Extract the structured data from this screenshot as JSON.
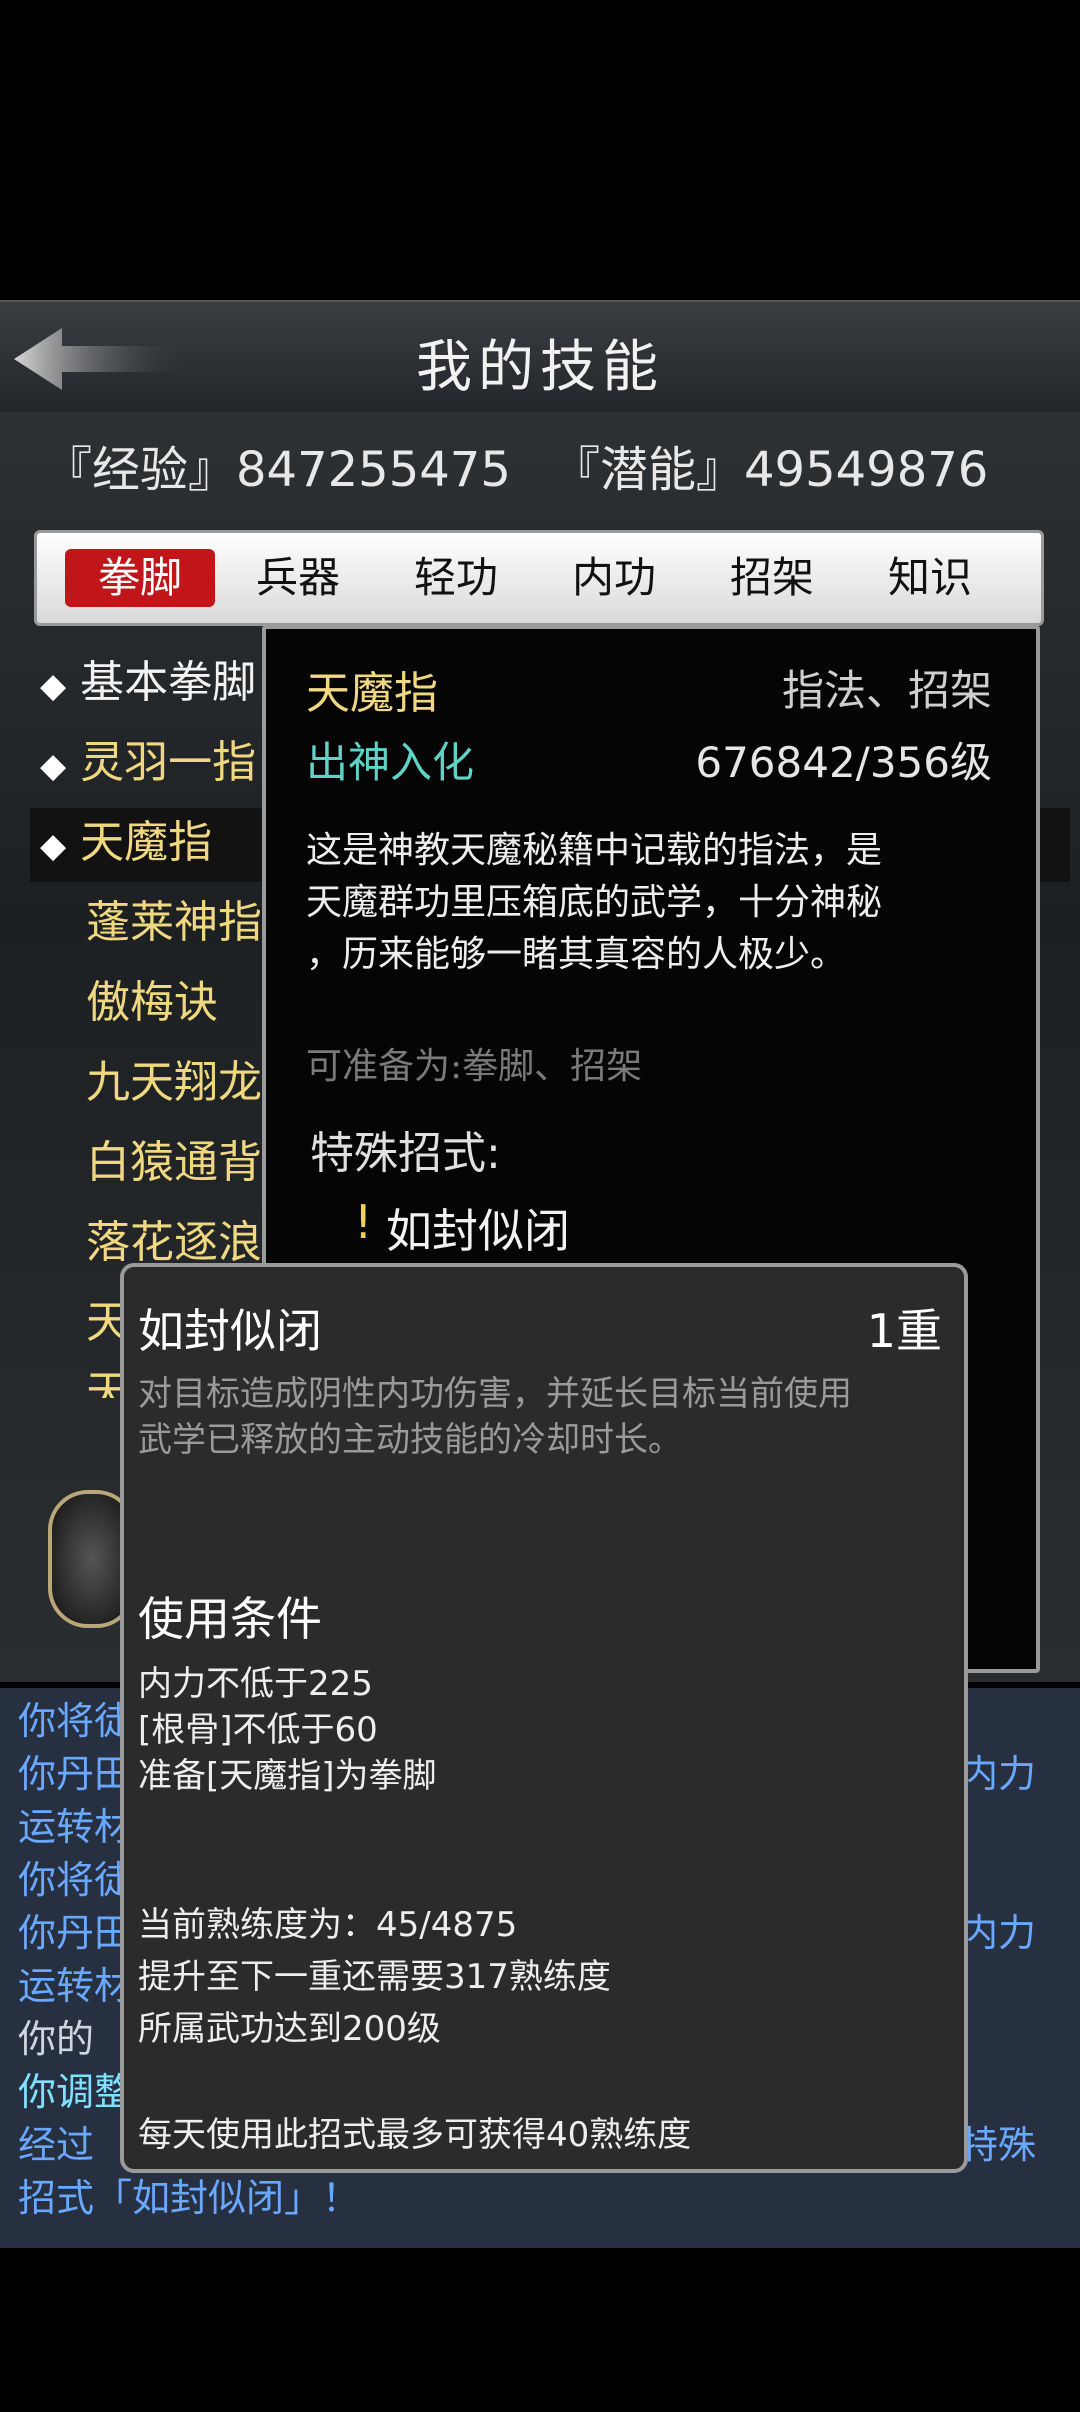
{
  "header": {
    "title": "我的技能"
  },
  "stats": {
    "exp_label": "『经验』847255475",
    "pot_label": "『潜能』49549876"
  },
  "tabs": [
    "拳脚",
    "兵器",
    "轻功",
    "内功",
    "招架",
    "知识"
  ],
  "skill_list": [
    {
      "label": "基本拳脚",
      "diamond": true
    },
    {
      "label": "灵羽一指",
      "diamond": true
    },
    {
      "label": "天魔指",
      "diamond": true
    },
    {
      "label": "蓬莱神指",
      "diamond": false
    },
    {
      "label": "傲梅诀",
      "diamond": false
    },
    {
      "label": "九天翔龙",
      "diamond": false
    },
    {
      "label": "白猿通背",
      "diamond": false
    },
    {
      "label": "落花逐浪",
      "diamond": false
    },
    {
      "label": "天",
      "diamond": false
    },
    {
      "label": "天",
      "diamond": false
    }
  ],
  "detail": {
    "name": "天魔指",
    "type": "指法、招架",
    "rank": "出神入化",
    "level": "676842/356级",
    "description": [
      "这是神教天魔秘籍中记载的指法，是",
      "天魔群功里压箱底的武学，十分神秘",
      "，历来能够一睹其真容的人极少。"
    ],
    "prepare": "可准备为:拳脚、招架",
    "special_heading": "特殊招式:",
    "special_mark": "!",
    "special_move": "如封似闭"
  },
  "tooltip": {
    "name": "如封似闭",
    "tier": "1重",
    "desc_line1": "对目标造成阴性内功伤害，并延长目标当前使用",
    "desc_line2": "武学已释放的主动技能的冷却时长。",
    "conditions_heading": "使用条件",
    "cond1": "内力不低于225",
    "cond2": "[根骨]不低于60",
    "cond3": "准备[天魔指]为拳脚",
    "prof1": "当前熟练度为：45/4875",
    "prof2": "提升至下一重还需要317熟练度",
    "prof3": "所属武功达到200级",
    "daily": "每天使用此招式最多可获得40熟练度"
  },
  "log": {
    "l1": "你将徒",
    "l2": "你丹田",
    "l2r": "内力",
    "l3": "运转材",
    "l4": "你将徒",
    "l5": "你丹田",
    "l5r": "内力",
    "l6": "运转材",
    "l7": "你的",
    "l8": "你调整",
    "l9": "经过",
    "l9r": "特殊",
    "l10": "招式「如封似闭」！"
  },
  "colors": {
    "accent_red": "#c0161a",
    "skill_gold": "#f0d880",
    "rank_teal": "#5fd3c7"
  }
}
